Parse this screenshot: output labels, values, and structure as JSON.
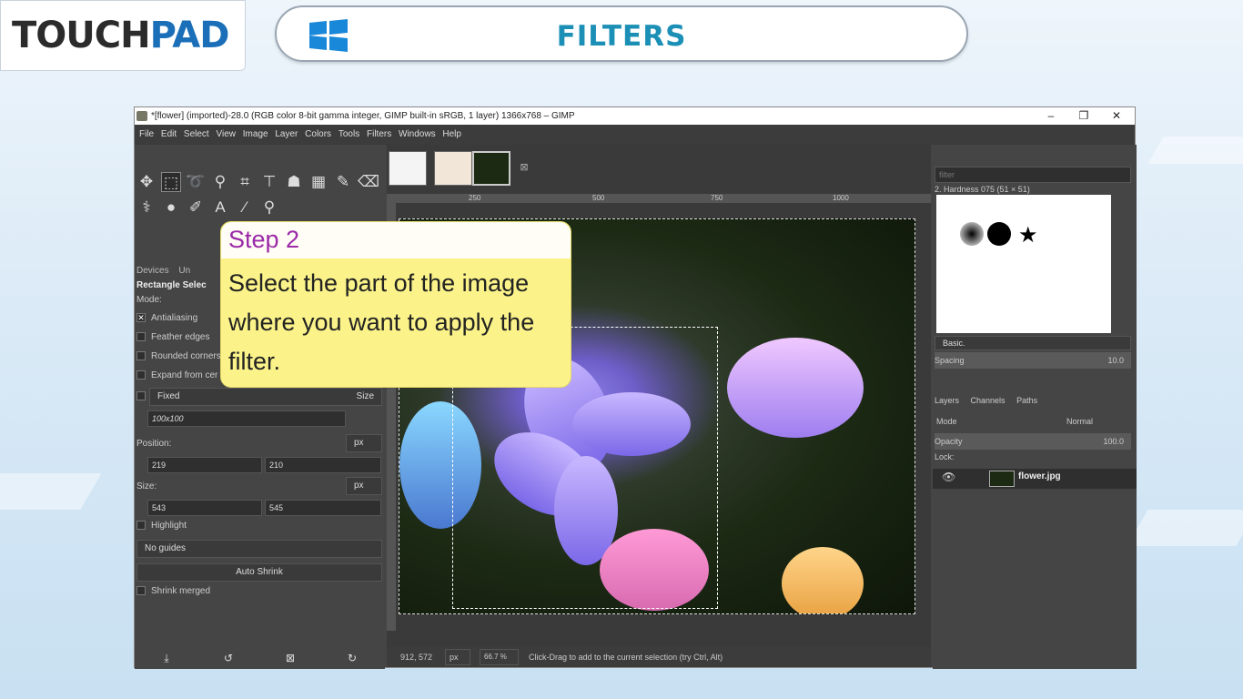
{
  "brand": {
    "part1": "TOUCH",
    "part2": "PAD"
  },
  "banner": {
    "title": "FILTERS"
  },
  "window": {
    "title": "*[flower] (imported)-28.0 (RGB color 8-bit gamma integer, GIMP built-in sRGB, 1 layer) 1366x768 – GIMP",
    "controls": {
      "minimize": "–",
      "restore": "❐",
      "close": "✕"
    }
  },
  "menu": [
    "File",
    "Edit",
    "Select",
    "View",
    "Image",
    "Layer",
    "Colors",
    "Tools",
    "Filters",
    "Windows",
    "Help"
  ],
  "tool_options": {
    "tabs": [
      "Devices",
      "Un"
    ],
    "tool_name": "Rectangle Selec",
    "mode_label": "Mode:",
    "antialiasing": "Antialiasing",
    "feather": "Feather edges",
    "rounded": "Rounded corners",
    "expand": "Expand from cer",
    "fixed": "Fixed",
    "fixed_type": "Size",
    "ratio": "100x100",
    "position_label": "Position:",
    "pos_unit": "px",
    "pos_x": "219",
    "pos_y": "210",
    "size_label": "Size:",
    "size_unit": "px",
    "size_w": "543",
    "size_h": "545",
    "highlight": "Highlight",
    "guides": "No guides",
    "auto_shrink": "Auto Shrink",
    "shrink_merged": "Shrink merged"
  },
  "rulers": {
    "marks": [
      "250",
      "500",
      "750",
      "1000"
    ]
  },
  "callout": {
    "heading": "Step 2",
    "body": "Select the part of the image where you want  to apply the filter."
  },
  "status": {
    "coords": "912, 572",
    "unit": "px",
    "zoom": "66.7 %",
    "message": "Click-Drag to add to the current selection (try Ctrl, Alt)"
  },
  "brushes": {
    "filter_placeholder": "filter",
    "current": "2. Hardness 075 (51 × 51)",
    "tag": "Basic.",
    "spacing_label": "Spacing",
    "spacing_value": "10.0"
  },
  "layers": {
    "tabs": [
      "Layers",
      "Channels",
      "Paths"
    ],
    "mode_label": "Mode",
    "mode_value": "Normal",
    "opacity_label": "Opacity",
    "opacity_value": "100.0",
    "lock_label": "Lock:",
    "layer_name": "flower.jpg"
  },
  "colors": {
    "accent": "#1b8fb5",
    "callout_bg": "#fbf38a",
    "callout_heading": "#9b2aa8"
  }
}
